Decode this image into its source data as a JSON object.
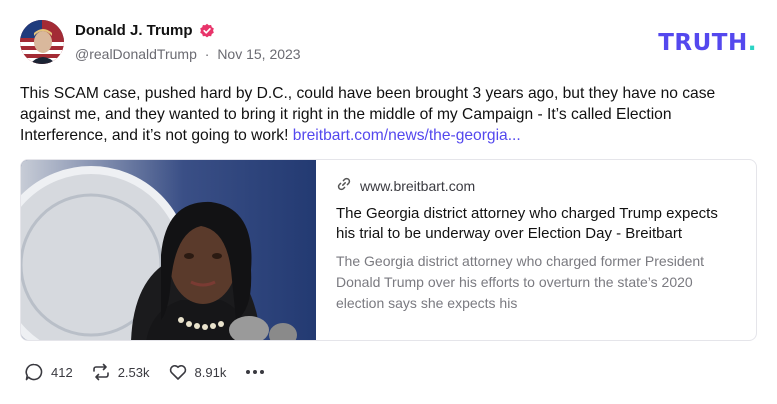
{
  "author": {
    "display_name": "Donald J. Trump",
    "handle": "@realDonaldTrump",
    "separator": "·",
    "date": "Nov 15, 2023"
  },
  "brand": {
    "name_main": "TRUTH",
    "name_accent": ".",
    "color": "#5448ee",
    "accent_color": "#2bd4c4"
  },
  "post": {
    "text": "This SCAM case, pushed hard by D.C., could have been brought 3 years ago, but they have no case against me, and they wanted to bring it right in the middle of my Campaign - It’s called Election Interference, and it’s not going to work! ",
    "link_text": "breitbart.com/news/the-georgia..."
  },
  "link_card": {
    "domain": "www.breitbart.com",
    "title": "The Georgia district attorney who charged Trump expects his trial to be underway over Election Day - Breitbart",
    "description": "The Georgia district attorney who charged former President Donald Trump over his efforts to overturn the state’s 2020 election says she expects his"
  },
  "actions": {
    "replies": "412",
    "retruths": "2.53k",
    "likes": "8.91k"
  },
  "icons": [
    "verified-badge-icon",
    "link-icon",
    "reply-icon",
    "retruth-icon",
    "like-icon",
    "more-icon"
  ],
  "colors": {
    "verified": "#e8346a",
    "link": "#5448ee"
  }
}
